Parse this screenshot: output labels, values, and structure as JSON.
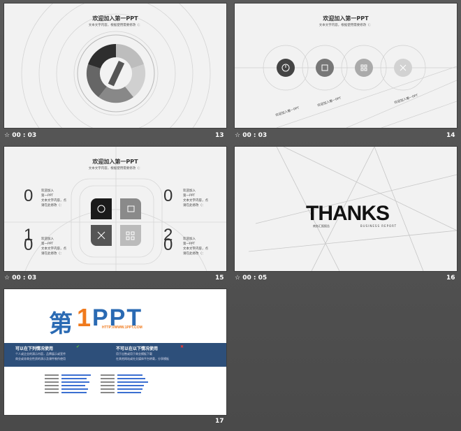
{
  "slides": {
    "s13": {
      "title": "欢迎加入第一PPT",
      "subtitle": "文本文字内容，根据使用需要修改（：",
      "time": "00 : 03",
      "number": "13"
    },
    "s14": {
      "title": "欢迎加入第一PPT",
      "subtitle": "文本文字内容，根据使用需要修改（：",
      "time": "00 : 03",
      "number": "14",
      "labels": [
        "欢迎加入第一PPT",
        "文本文字内容，根据使用需要修改"
      ]
    },
    "s15": {
      "title": "欢迎加入第一PPT",
      "subtitle": "文本文字内容，根据使用需要修改（：",
      "time": "00 : 03",
      "number": "15",
      "digits": [
        "0",
        "1",
        "0",
        "0",
        "2",
        "0"
      ],
      "text_a": [
        "欢迎加入",
        "第一PPT",
        "文本文字内容，点",
        "请在此修改（："
      ],
      "text_b": [
        "欢迎加入",
        "第一PPT",
        "文本文字内容，点",
        "请在此修改（："
      ]
    },
    "s16": {
      "thanks": "THANKS",
      "sub_cn": "商务汇报报告",
      "sub_en": "BUSINESS REPORT",
      "time": "00 : 05",
      "number": "16"
    },
    "s17": {
      "number": "17",
      "logo_cn": "第",
      "logo_one": "1",
      "logo_ppt": "PPT",
      "logo_url": "HTTP://WWW.1PPT.COM",
      "can_title": "可以在下列情况使用",
      "cannot_title": "不可以在以下情况使用",
      "can_lines": [
        "个人或企业的演示内容，品牌展示或宣传",
        "商业或非商业性质的演示及课件制作使用"
      ],
      "cannot_lines": [
        "用于出售或用于商业模板下载",
        "在其他网站或社交媒体平台转载，分享模板"
      ]
    }
  },
  "colors": {
    "slide_bg": "#f2f2f2",
    "dark": "#333333",
    "band": "#2d4f7a",
    "logo_blue": "#2a6ab3",
    "logo_orange": "#f07a1d"
  },
  "icons": [
    "clock-icon",
    "transfer-icon",
    "grid-icon",
    "tools-icon",
    "home-icon",
    "chart-icon",
    "cart-icon",
    "check-icon",
    "cross-icon",
    "play-icon"
  ]
}
